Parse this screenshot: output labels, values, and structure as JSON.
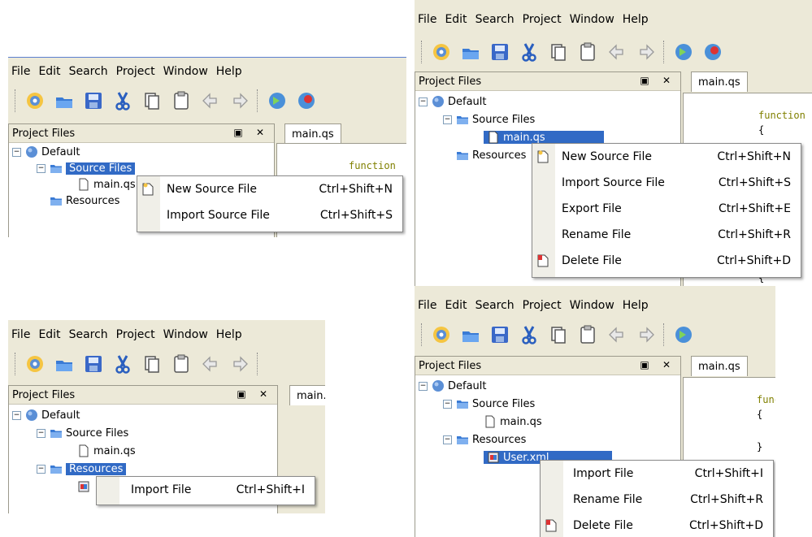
{
  "menu_bar": [
    "File",
    "Edit",
    "Search",
    "Project",
    "Window",
    "Help"
  ],
  "dock_title": "Project Files",
  "dock_buttons": "▣ ✕",
  "tab_label": "main.qs",
  "tree": {
    "root": "Default",
    "source_files": "Source Files",
    "main_file": "main.qs",
    "resources": "Resources",
    "user_file": "User.xml"
  },
  "code": {
    "keyword": "function",
    "brace": "{",
    "close_brace": "}"
  },
  "panel1_menu": [
    {
      "label": "New Source File",
      "shortcut": "Ctrl+Shift+N"
    },
    {
      "label": "Import Source File",
      "shortcut": "Ctrl+Shift+S"
    }
  ],
  "panel2_menu": [
    {
      "label": "New Source File",
      "shortcut": "Ctrl+Shift+N"
    },
    {
      "label": "Import Source File",
      "shortcut": "Ctrl+Shift+S"
    },
    {
      "label": "Export File",
      "shortcut": "Ctrl+Shift+E"
    },
    {
      "label": "Rename File",
      "shortcut": "Ctrl+Shift+R"
    },
    {
      "label": "Delete File",
      "shortcut": "Ctrl+Shift+D"
    }
  ],
  "panel3_menu": [
    {
      "label": "Import File",
      "shortcut": "Ctrl+Shift+I"
    }
  ],
  "panel4_menu": [
    {
      "label": "Import File",
      "shortcut": "Ctrl+Shift+I"
    },
    {
      "label": "Rename File",
      "shortcut": "Ctrl+Shift+R"
    },
    {
      "label": "Delete File",
      "shortcut": "Ctrl+Shift+D"
    }
  ],
  "colors": {
    "selection": "#316ac5",
    "chrome": "#ece9d8",
    "keyword": "#808000"
  }
}
